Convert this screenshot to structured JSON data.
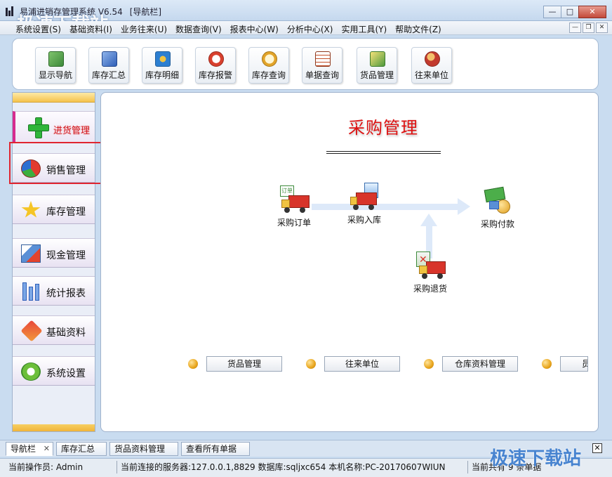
{
  "window": {
    "title": "易浦进销存管理系统 V6.54",
    "title_tag": "[导航栏]",
    "buttons": {
      "minimize": "—",
      "maximize": "□",
      "close": "✕"
    }
  },
  "watermark": {
    "top_left": "极速下载站",
    "bottom_right": "极速下载站"
  },
  "menu": {
    "items": [
      {
        "label": "系统设置(S)"
      },
      {
        "label": "基础资料(I)"
      },
      {
        "label": "业务往来(U)"
      },
      {
        "label": "数据查询(V)"
      },
      {
        "label": "报表中心(W)"
      },
      {
        "label": "分析中心(X)"
      },
      {
        "label": "实用工具(Y)"
      },
      {
        "label": "帮助文件(Z)"
      }
    ],
    "mdi": {
      "minimize": "—",
      "restore": "❐",
      "close": "✕"
    }
  },
  "toolbar": {
    "buttons": [
      {
        "label": "显示导航",
        "icon": "navigation-grid-icon",
        "color": "#3d8a3a"
      },
      {
        "label": "库存汇总",
        "icon": "bar-chart-icon",
        "color": "#2f5fb8"
      },
      {
        "label": "库存明细",
        "icon": "pie-window-icon",
        "color": "#2c7fd1"
      },
      {
        "label": "库存报警",
        "icon": "alarm-clock-icon",
        "color": "#d8402e"
      },
      {
        "label": "库存查询",
        "icon": "magnifier-icon",
        "color": "#e2a429"
      },
      {
        "label": "单据查询",
        "icon": "spreadsheet-icon",
        "color": "#c2502a"
      },
      {
        "label": "货品管理",
        "icon": "goods-box-icon",
        "color": "#4f9a3c"
      },
      {
        "label": "往来单位",
        "icon": "people-icon",
        "color": "#c23a2e"
      }
    ]
  },
  "nav": {
    "items": [
      {
        "label": "进货管理",
        "icon": "green-plus-icon",
        "active": true
      },
      {
        "label": "销售管理",
        "icon": "pie-ball-icon",
        "active": false
      },
      {
        "label": "库存管理",
        "icon": "star-icon",
        "active": false
      },
      {
        "label": "现金管理",
        "icon": "cash-chart-icon",
        "active": false
      },
      {
        "label": "统计报表",
        "icon": "bar-stats-icon",
        "active": false
      },
      {
        "label": "基础资料",
        "icon": "brush-icon",
        "active": false
      },
      {
        "label": "系统设置",
        "icon": "gear-icon",
        "active": false
      }
    ]
  },
  "panel": {
    "title": "采购管理",
    "flow": {
      "order": "采购订单",
      "order_tag": "订单",
      "inbound": "采购入库",
      "payment": "采购付款",
      "return": "采购退货"
    },
    "links": [
      {
        "label": "货品管理"
      },
      {
        "label": "往来单位"
      },
      {
        "label": "仓库资料管理"
      },
      {
        "label": "员"
      }
    ]
  },
  "tabs": [
    {
      "label": "导航栏",
      "active": true,
      "close": "✕"
    },
    {
      "label": "库存汇总",
      "active": false
    },
    {
      "label": "货品资料管理",
      "active": false
    },
    {
      "label": "查看所有单据",
      "active": false
    }
  ],
  "tabbar_close": "✕",
  "status": {
    "operator": "当前操作员: Admin",
    "connection": "当前连接的服务器:127.0.0.1,8829 数据库:sqljxc654 本机名称:PC-20170607WIUN",
    "count": "当前共有 9 条单据"
  },
  "colors": {
    "accent_red": "#d11111",
    "nav_active_bar": "#d62c8f",
    "highlight_box": "#e02630",
    "nav_gold": "#f5c34c"
  }
}
